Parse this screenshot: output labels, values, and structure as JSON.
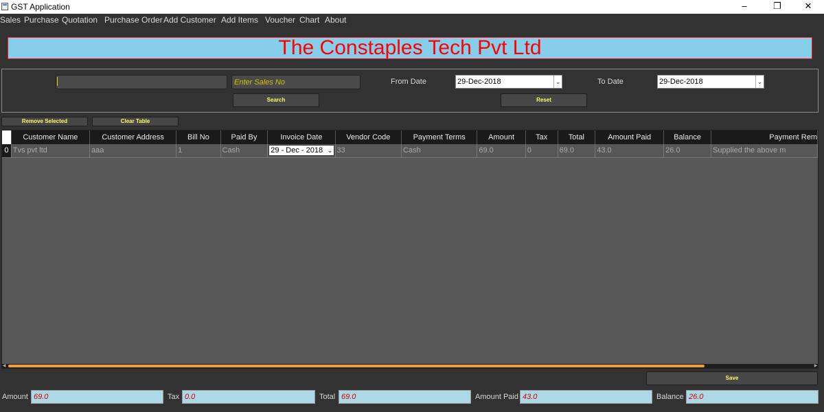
{
  "window": {
    "title": "GST Application"
  },
  "menu": [
    "Sales",
    "Purchase",
    "Quotation",
    "Purchase Order",
    "Add Customer",
    "Add Items",
    "Voucher",
    "Chart",
    "About"
  ],
  "banner": {
    "text": "The Constaples Tech Pvt Ltd"
  },
  "filters": {
    "customer_value": "",
    "sales_no_placeholder": "Enter Sales No",
    "from_date_label": "From Date",
    "from_date": "29-Dec-2018",
    "to_date_label": "To Date",
    "to_date": "29-Dec-2018",
    "search_label": "Search",
    "reset_label": "Reset"
  },
  "actions": {
    "remove_selected": "Remove Selected",
    "clear_table": "Clear Table",
    "save": "Save"
  },
  "table": {
    "columns": [
      "Customer Name",
      "Customer Address",
      "Bill No",
      "Paid By",
      "Invoice Date",
      "Vendor Code",
      "Payment Terms",
      "Amount",
      "Tax",
      "Total",
      "Amount Paid",
      "Balance",
      "Payment Rem"
    ],
    "rows": [
      {
        "index": "0",
        "customer_name": "Tvs pvt ltd",
        "customer_address": "aaa",
        "bill_no": "1",
        "paid_by": "Cash",
        "invoice_date": "29 - Dec - 2018",
        "vendor_code": "33",
        "payment_terms": "Cash",
        "amount": "69.0",
        "tax": "0",
        "total": "69.0",
        "amount_paid": "43.0",
        "balance": "26.0",
        "payment_remarks": "Supplied the above m"
      }
    ]
  },
  "totals": {
    "amount_label": "Amount",
    "amount": "69.0",
    "tax_label": "Tax",
    "tax": "0.0",
    "total_label": "Total",
    "total": "69.0",
    "amount_paid_label": "Amount Paid",
    "amount_paid": "43.0",
    "balance_label": "Balance",
    "balance": "26.0"
  }
}
